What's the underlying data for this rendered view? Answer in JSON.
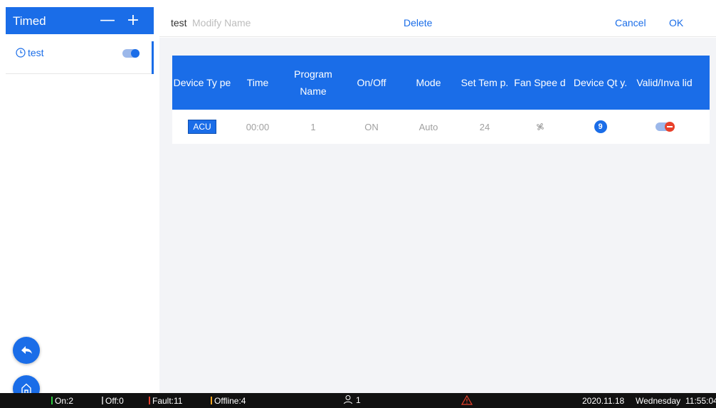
{
  "sidebar": {
    "title": "Timed",
    "minus_label": "—",
    "plus_label": "+",
    "items": [
      {
        "name": "test",
        "enabled": true
      }
    ]
  },
  "topbar": {
    "name_value": "test",
    "name_placeholder": "Modify Name",
    "delete_label": "Delete",
    "cancel_label": "Cancel",
    "ok_label": "OK"
  },
  "table": {
    "headers": [
      "Device Ty pe",
      "Time",
      "Program Name",
      "On/Off",
      "Mode",
      "Set Tem p.",
      "Fan Spee d",
      "Device Qt y.",
      "Valid/Inva lid"
    ],
    "rows": [
      {
        "device_type": "ACU",
        "time": "00:00",
        "program": "1",
        "onoff": "ON",
        "mode": "Auto",
        "set_temp": "24",
        "fan_speed_icon": "fan-icon",
        "device_qty": "9",
        "valid": false
      }
    ]
  },
  "status_bar": {
    "on": "On:2",
    "off": "Off:0",
    "fault": "Fault:11",
    "offline": "Offline:4",
    "users": "1",
    "date": "2020.11.18",
    "day": "Wednesday",
    "time": "11:55:04",
    "colors": {
      "on": "#2ecc40",
      "off": "#aaaaaa",
      "fault": "#e8402a",
      "offline": "#f5a623",
      "warning": "#e8402a"
    }
  },
  "colors": {
    "accent": "#1a6de8"
  }
}
